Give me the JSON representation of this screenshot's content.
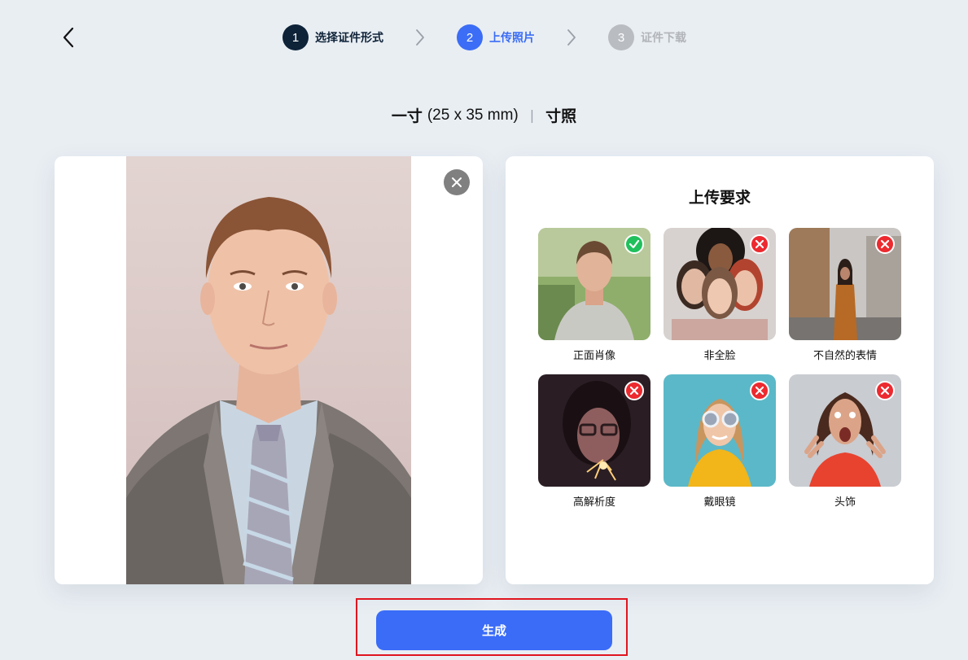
{
  "stepper": {
    "steps": [
      {
        "number": "1",
        "label": "选择证件形式",
        "state": "done"
      },
      {
        "number": "2",
        "label": "上传照片",
        "state": "active"
      },
      {
        "number": "3",
        "label": "证件下载",
        "state": "todo"
      }
    ]
  },
  "size": {
    "name": "一寸",
    "dims": "(25 x 35 mm)",
    "separator": "|",
    "type": "寸照"
  },
  "requirements": {
    "title": "上传要求",
    "samples": [
      {
        "caption": "正面肖像",
        "status": "ok"
      },
      {
        "caption": "非全脸",
        "status": "bad"
      },
      {
        "caption": "不自然的表情",
        "status": "bad"
      },
      {
        "caption": "高解析度",
        "status": "bad"
      },
      {
        "caption": "戴眼镜",
        "status": "bad"
      },
      {
        "caption": "头饰",
        "status": "bad"
      }
    ]
  },
  "actions": {
    "generate_label": "生成"
  },
  "colors": {
    "primary": "#3a6cf8",
    "step_done": "#0e2238",
    "ok": "#20c05c",
    "bad": "#ec2a2f",
    "highlight": "#e0161f"
  },
  "icons": [
    "back-chevron-icon",
    "step-chevron-icon",
    "close-icon",
    "check-icon",
    "cross-icon"
  ]
}
